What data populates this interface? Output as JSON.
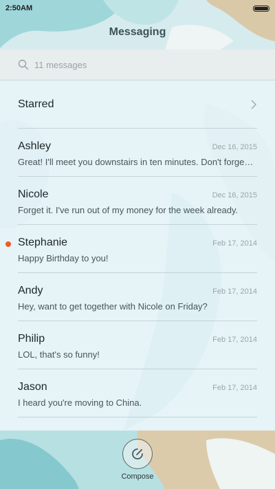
{
  "status_bar": {
    "time": "2:50AM",
    "battery_level": 1.0
  },
  "app": {
    "title": "Messaging"
  },
  "search": {
    "placeholder": "11 messages"
  },
  "starred": {
    "label": "Starred"
  },
  "messages": [
    {
      "name": "Ashley",
      "date": "Dec 16, 2015",
      "preview": "Great! I'll meet you downstairs in ten minutes. Don't forge…",
      "unread": false
    },
    {
      "name": "Nicole",
      "date": "Dec 16, 2015",
      "preview": "Forget it. I've run out of my money for the week already.",
      "unread": false
    },
    {
      "name": "Stephanie",
      "date": "Feb 17, 2014",
      "preview": "Happy Birthday to you!",
      "unread": true
    },
    {
      "name": "Andy",
      "date": "Feb 17, 2014",
      "preview": "Hey, want to get together with Nicole on Friday?",
      "unread": false
    },
    {
      "name": "Philip",
      "date": "Feb 17, 2014",
      "preview": "LOL, that's so funny!",
      "unread": false
    },
    {
      "name": "Jason",
      "date": "Feb 17, 2014",
      "preview": "I heard you're moving to China.",
      "unread": false
    }
  ],
  "compose": {
    "label": "Compose"
  },
  "colors": {
    "unread_dot": "#f05a24",
    "wallpaper_teal": "#8fcfd4",
    "wallpaper_sand": "#d8c7a5"
  }
}
